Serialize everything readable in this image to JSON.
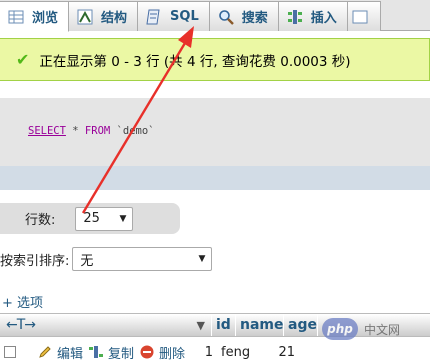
{
  "tabs": [
    {
      "label": "浏览",
      "icon": "browse-icon"
    },
    {
      "label": "结构",
      "icon": "structure-icon"
    },
    {
      "label": "SQL",
      "icon": "sql-icon"
    },
    {
      "label": "搜索",
      "icon": "search-icon"
    },
    {
      "label": "插入",
      "icon": "insert-icon"
    }
  ],
  "message": {
    "text": "正在显示第 0 - 3 行 (共 4 行, 查询花费 0.0003 秒)",
    "color": "#ebf8a4"
  },
  "sql": {
    "select": "SELECT",
    "star": "*",
    "from": "FROM",
    "table": "`demo`"
  },
  "rows": {
    "label": "行数:",
    "value": "25"
  },
  "sort": {
    "label": "按索引排序:",
    "value": "无"
  },
  "options_link": "+ 选项",
  "table": {
    "columns": [
      "id",
      "name",
      "age"
    ],
    "nav_arrows": "←T→",
    "row": {
      "edit": "编辑",
      "copy": "复制",
      "delete": "删除",
      "id": "1",
      "name": "feng",
      "age": "21"
    }
  },
  "watermark": {
    "logo": "php",
    "text": "中文网"
  },
  "colors": {
    "accent": "#235a81",
    "annotation": "#e8302a",
    "success": "#52b818"
  }
}
